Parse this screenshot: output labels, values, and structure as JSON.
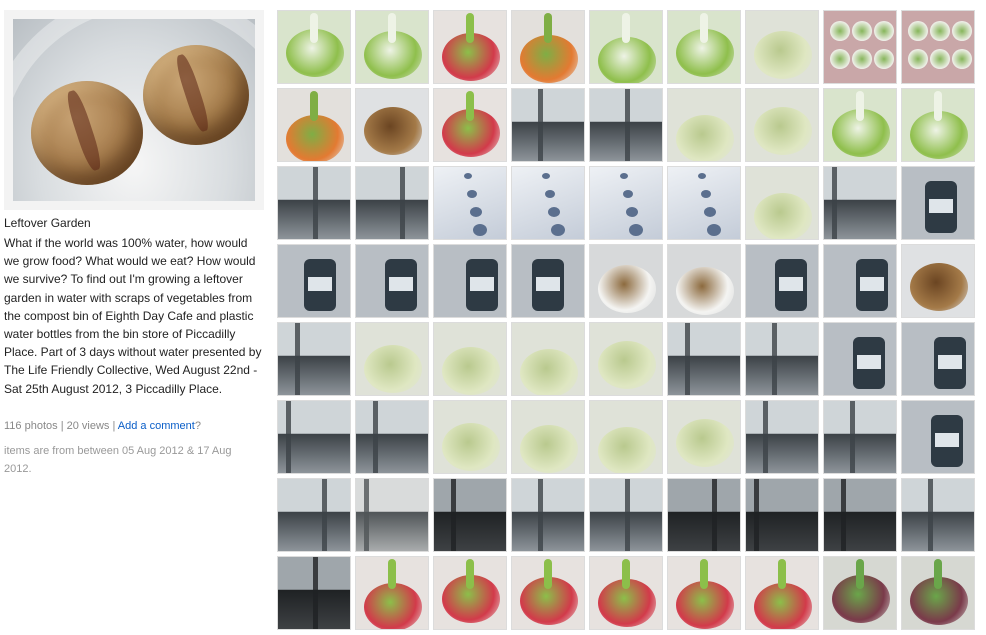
{
  "set": {
    "title": "Leftover Garden",
    "description": "What if the world was 100% water, how would we grow food? What would we eat? How would we survive? To find out I'm growing a leftover garden in water with scraps of vegetables from the compost bin of Eighth Day Cafe and plastic water bottles from the bin store of Piccadilly Place. Part of 3 days without water presented by The Life Friendly Collective, Wed August 22nd - Sat 25th August 2012, 3 Piccadilly Place.",
    "photos_count": "116 photos",
    "views_count": "20 views",
    "separator": "|",
    "add_comment_label": "Add a comment",
    "add_comment_suffix": "?",
    "date_range": "items are from between 05 Aug 2012 & 17 Aug 2012."
  },
  "grid": {
    "columns": 9,
    "rows": [
      [
        "bokchoy",
        "bokchoy",
        "radish",
        "carrot",
        "bokchoy",
        "bokchoy",
        "cabbage",
        "rosettes",
        "rosettes"
      ],
      [
        "carrot",
        "pits",
        "radish",
        "window",
        "window",
        "cabbage",
        "cabbage",
        "bokchoy",
        "bokchoy"
      ],
      [
        "window",
        "window",
        "table",
        "table",
        "table",
        "table",
        "cabbage",
        "window",
        "bottle"
      ],
      [
        "bottle",
        "bottle",
        "bottle",
        "bottle",
        "cup",
        "cup",
        "bottle",
        "bottle",
        "pits"
      ],
      [
        "window",
        "cabbage",
        "cabbage",
        "cabbage",
        "cabbage",
        "window",
        "window",
        "bottle",
        "bottle"
      ],
      [
        "window",
        "window",
        "cabbage",
        "cabbage",
        "cabbage",
        "cabbage",
        "window",
        "window",
        "bottle"
      ],
      [
        "window",
        "street",
        "dark",
        "window",
        "window",
        "dark",
        "dark",
        "dark",
        "window"
      ],
      [
        "dark",
        "radish",
        "radish",
        "radish",
        "radish",
        "radish",
        "radish",
        "beet",
        "beet"
      ]
    ],
    "palettes": {
      "bokchoy": {
        "bg": "#d9e4cc",
        "a": "#8fbf4c",
        "b": "#eef3e6"
      },
      "radish": {
        "bg": "#e7e2df",
        "a": "#d23a4a",
        "b": "#8cbf4a"
      },
      "carrot": {
        "bg": "#e3e0dc",
        "a": "#e37a32",
        "b": "#7fae45"
      },
      "cabbage": {
        "bg": "#dfe2d8",
        "a": "#dfe7c2",
        "b": "#b9c98e"
      },
      "rosettes": {
        "bg": "#c9a7a8",
        "a": "#f1f1ec",
        "b": "#86b55a"
      },
      "pits": {
        "bg": "#dfe1e3",
        "a": "#a47a48",
        "b": "#6b4522"
      },
      "window": {
        "bg": "#8d949a",
        "a": "#cfd5d8",
        "b": "#3c4247"
      },
      "table": {
        "bg": "#c4ccd8",
        "a": "#eef1f5",
        "b": "#5b6f8e"
      },
      "bottle": {
        "bg": "#b8bec4",
        "a": "#2e3a44",
        "b": "#dfe5ea"
      },
      "cup": {
        "bg": "#d7d9da",
        "a": "#f4f4f2",
        "b": "#8c6a3e"
      },
      "street": {
        "bg": "#a9acad",
        "a": "#d9dbdb",
        "b": "#505558"
      },
      "dark": {
        "bg": "#3e4144",
        "a": "#9fa6ab",
        "b": "#1f2224"
      },
      "beet": {
        "bg": "#d6d8d2",
        "a": "#7a3a4a",
        "b": "#6aa64a"
      }
    }
  }
}
